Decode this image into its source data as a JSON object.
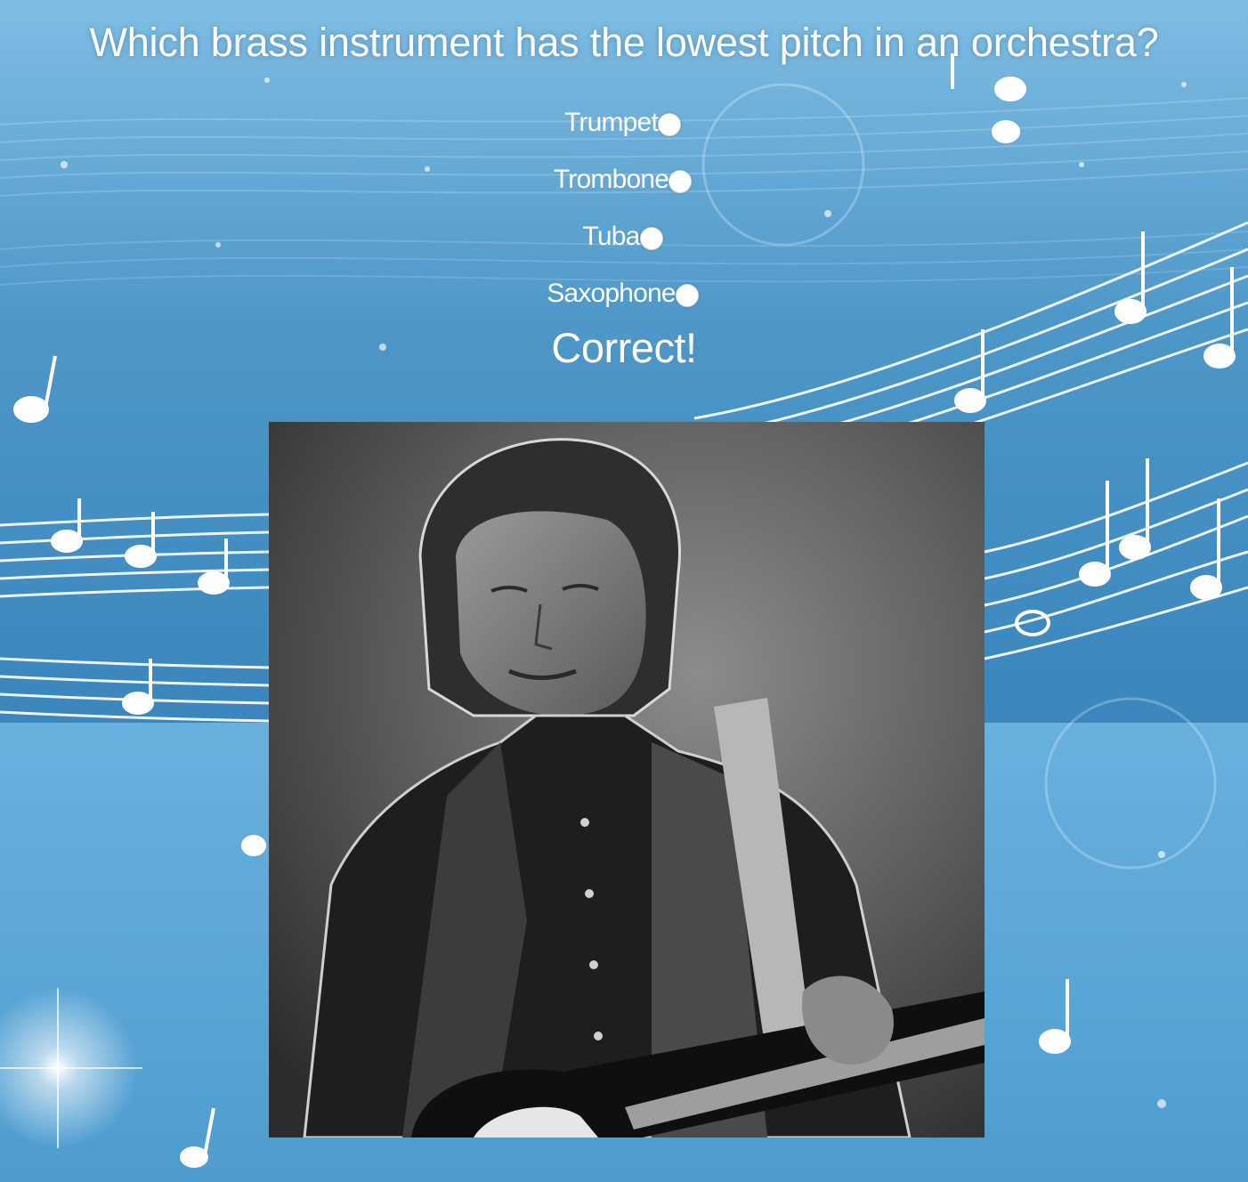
{
  "quiz": {
    "question": "Which brass instrument has the lowest pitch in an orchestra?",
    "options": [
      {
        "label": "Trumpet",
        "selected": false
      },
      {
        "label": "Trombone",
        "selected": false
      },
      {
        "label": "Tuba",
        "selected": false
      },
      {
        "label": "Saxophone",
        "selected": false
      }
    ],
    "result": "Correct!"
  },
  "colors": {
    "background_light": "#6cb6e0",
    "background_dark": "#3f8ac0",
    "text": "#ffffff"
  },
  "icons": {
    "background": "music-notes-background-icon",
    "photo": "guitarist-photo-icon"
  }
}
